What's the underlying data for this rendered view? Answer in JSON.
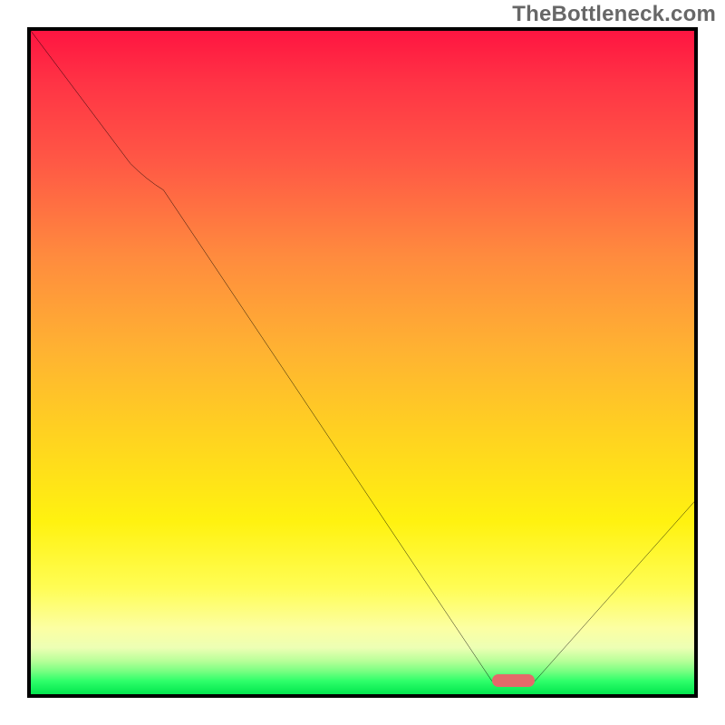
{
  "watermark": "TheBottleneck.com",
  "chart_data": {
    "type": "line",
    "title": "",
    "xlabel": "",
    "ylabel": "",
    "xlim": [
      0,
      100
    ],
    "ylim": [
      0,
      100
    ],
    "grid": false,
    "colors": {
      "gradient_top": "#ff1541",
      "gradient_mid_orange": "#ff8b3e",
      "gradient_mid_yellow": "#fff210",
      "gradient_bottom_green": "#02e64e",
      "curve": "#000000",
      "min_marker": "#e46a6a",
      "border": "#000000"
    },
    "series": [
      {
        "name": "bottleneck-curve",
        "x": [
          0,
          15,
          20,
          69.5,
          76,
          100
        ],
        "values": [
          100,
          80,
          76,
          2,
          2,
          29
        ]
      }
    ],
    "markers": [
      {
        "name": "optimal-pill",
        "x_start": 69.5,
        "x_end": 76,
        "y": 2
      }
    ],
    "notes": "Value axis expressed as percent of plot height (0 at bottom). Curve starts at top-left corner, descends with a slight knee around x≈15–20, reaches a flat minimum marked by a red pill near x≈70–76, then rises toward x=100."
  }
}
